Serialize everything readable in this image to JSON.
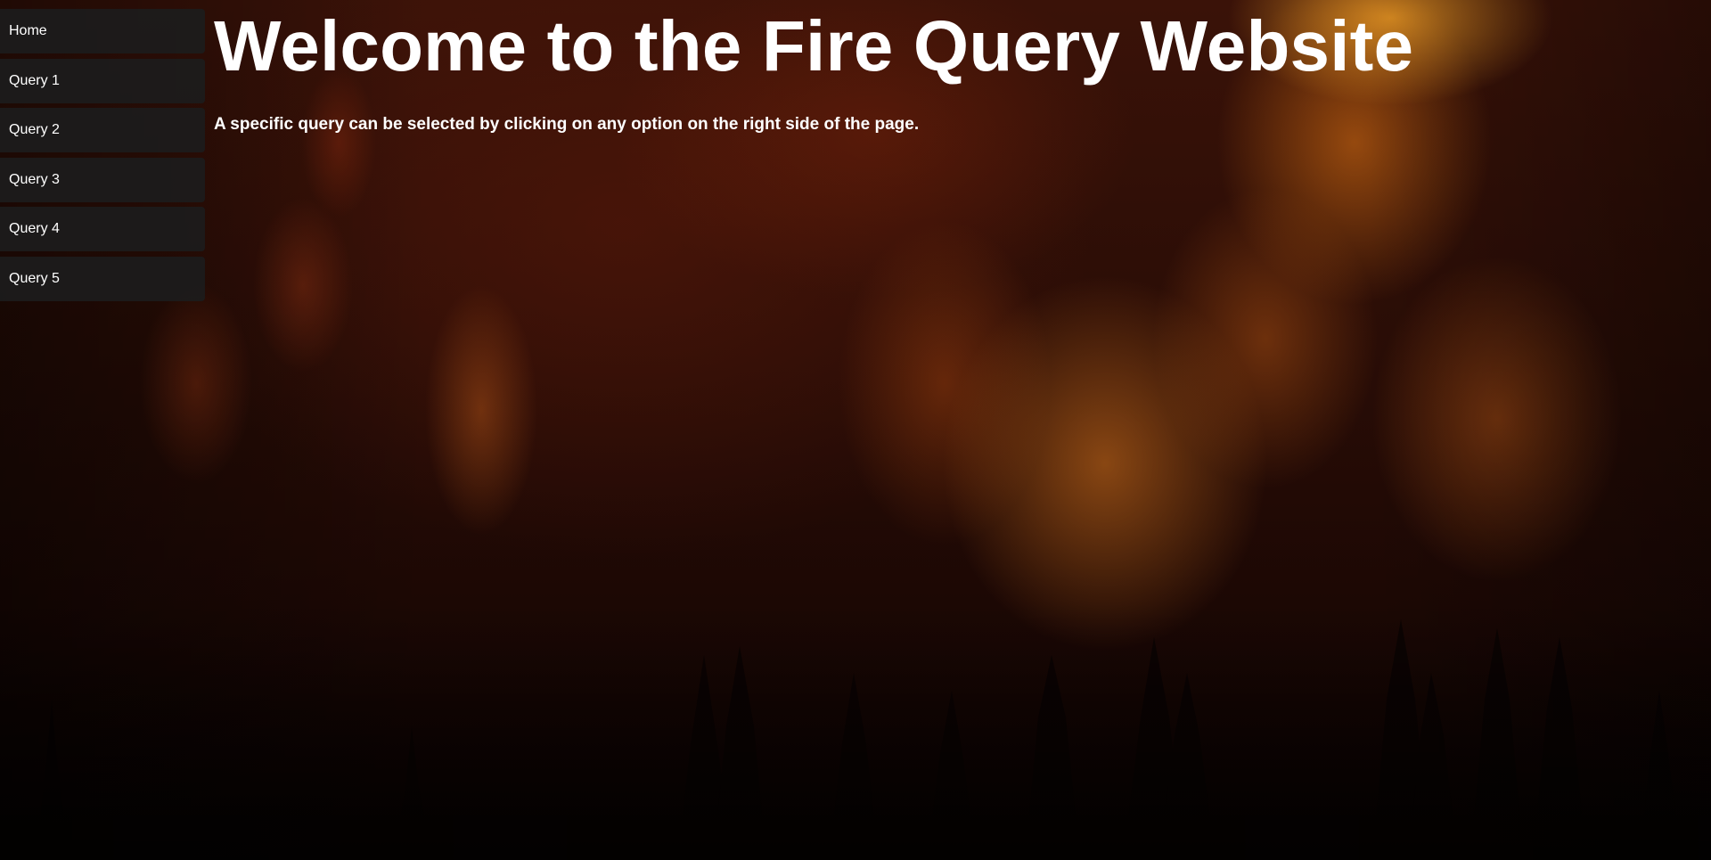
{
  "nav": {
    "items": [
      {
        "label": "Home"
      },
      {
        "label": "Query 1"
      },
      {
        "label": "Query 2"
      },
      {
        "label": "Query 3"
      },
      {
        "label": "Query 4"
      },
      {
        "label": "Query 5"
      }
    ]
  },
  "main": {
    "title": "Welcome to the Fire Query Website",
    "subtitle": "A specific query can be selected by clicking on any option on the right side of the page."
  },
  "background": {
    "image": "forest-fire-image"
  },
  "colors": {
    "nav_bg": "#1c1c1c",
    "text": "#ffffff",
    "fire_orange": "#e07818",
    "dark_red": "#2a0d06"
  }
}
